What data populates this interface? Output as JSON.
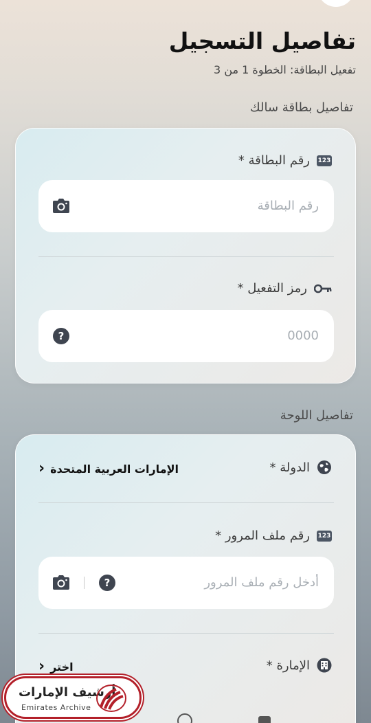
{
  "header": {
    "title": "تفاصيل التسجيل",
    "subtitle": "تفعيل البطاقة: الخطوة 1 من 3"
  },
  "card_section": {
    "title": "تفاصيل بطاقة سالك",
    "card_number": {
      "label": "رقم البطاقة *",
      "badge": "123",
      "placeholder": "رقم البطاقة"
    },
    "activation_code": {
      "label": "رمز التفعيل *",
      "placeholder": "0000"
    }
  },
  "plate_section": {
    "title": "تفاصيل اللوحة",
    "country": {
      "label": "الدولة *",
      "value": "الإمارات العربية المتحدة"
    },
    "traffic_file": {
      "label": "رقم ملف المرور *",
      "badge": "123",
      "placeholder": "أدخل رقم ملف المرور"
    },
    "emirate": {
      "label": "الإمارة *",
      "value": "اختر"
    }
  },
  "help_symbol": "?",
  "chevron": "‹",
  "watermark": {
    "arabic": "أرشيف الإمارات",
    "english": "Emirates Archive"
  }
}
